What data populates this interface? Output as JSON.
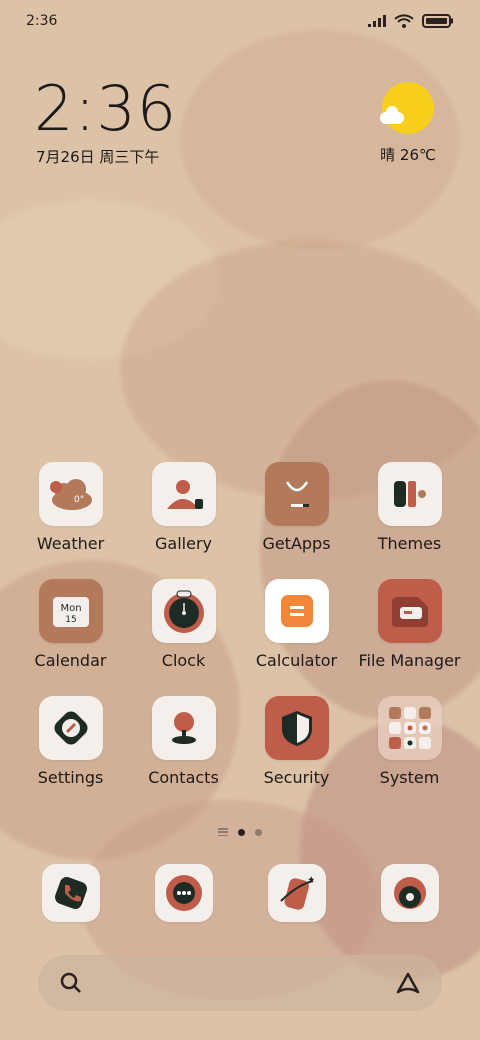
{
  "status_bar": {
    "time": "2:36"
  },
  "lock_clock": {
    "time": "2:36",
    "date": "7月26日 周三下午"
  },
  "weather": {
    "text": "晴 26℃"
  },
  "apps": [
    {
      "label": "Weather",
      "icon": "weather-cloud-icon",
      "badge": "0°"
    },
    {
      "label": "Gallery",
      "icon": "gallery-icon"
    },
    {
      "label": "GetApps",
      "icon": "shopping-bag-icon"
    },
    {
      "label": "Themes",
      "icon": "themes-icon"
    },
    {
      "label": "Calendar",
      "icon": "calendar-icon",
      "badge_day": "Mon",
      "badge_num": "15"
    },
    {
      "label": "Clock",
      "icon": "clock-icon"
    },
    {
      "label": "Calculator",
      "icon": "calculator-icon"
    },
    {
      "label": "File Manager",
      "icon": "folder-icon"
    },
    {
      "label": "Settings",
      "icon": "settings-icon"
    },
    {
      "label": "Contacts",
      "icon": "contacts-icon"
    },
    {
      "label": "Security",
      "icon": "shield-icon"
    },
    {
      "label": "System",
      "icon": "folder-grid-icon"
    }
  ],
  "dock": [
    {
      "icon": "phone-icon"
    },
    {
      "icon": "messages-icon"
    },
    {
      "icon": "browser-icon"
    },
    {
      "icon": "camera-icon"
    }
  ],
  "colors": {
    "accent_rust": "#bd5d4a",
    "accent_brown": "#b27a5b",
    "dark": "#1e2b24",
    "icon_bg": "#f4efea",
    "sun": "#f7cf1c"
  }
}
